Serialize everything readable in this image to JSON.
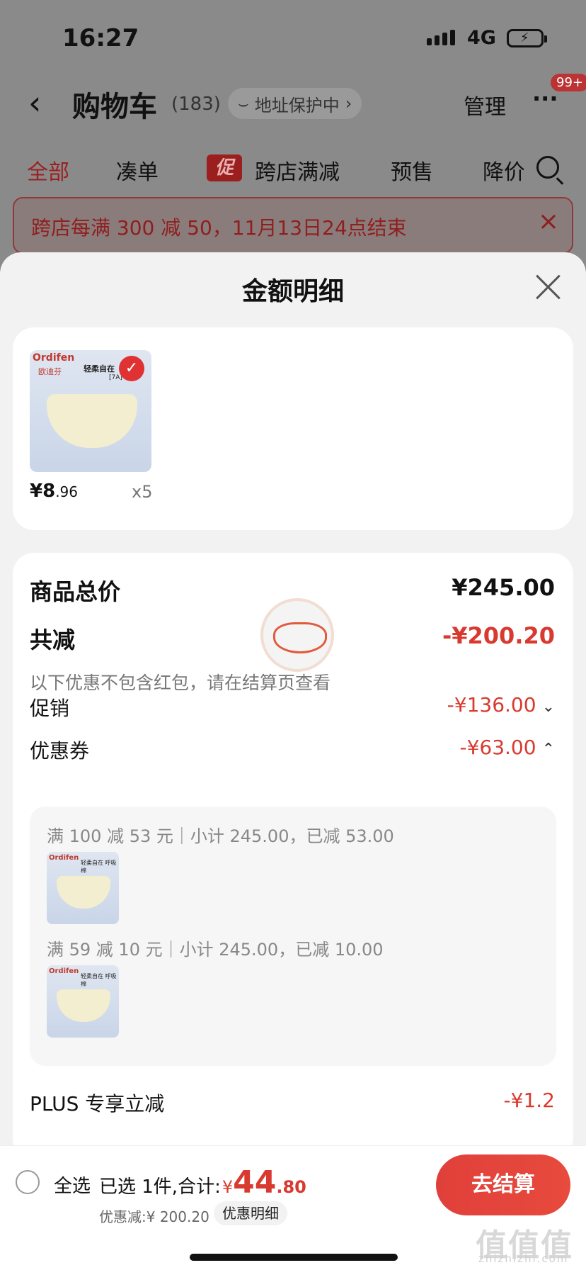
{
  "status": {
    "time": "16:27",
    "network": "4G"
  },
  "nav": {
    "back": "‹",
    "title": "购物车",
    "count": "(183)",
    "address": "地址保护中",
    "manage": "管理",
    "more": "···",
    "badge": "99+"
  },
  "tabs": {
    "items": [
      "全部",
      "凑单",
      "跨店满减",
      "预售",
      "降价"
    ],
    "promo_tag": "促"
  },
  "banner": {
    "text": "跨店每满 300 减 50，11月13日24点结束"
  },
  "sheet": {
    "title": "金额明细",
    "item": {
      "brand": "Ordifen",
      "brand_cn": "欧迪芬",
      "tagline": "轻柔自在",
      "tagline2": "[7A]",
      "price_int": "¥8",
      "price_dec": ".96",
      "qty": "x5"
    },
    "summary": {
      "total_label": "商品总价",
      "total_value": "¥245.00",
      "reduce_label": "共减",
      "reduce_value": "-¥200.20",
      "note": "以下优惠不包含红包，请在结算页查看",
      "promo_label": "促销",
      "promo_value": "-¥136.00",
      "coupon_label": "优惠券",
      "coupon_value": "-¥63.00",
      "coupon1": "满 100 减 53 元｜小计 245.00，已减 53.00",
      "coupon2": "满 59 减 10 元｜小计 245.00，已减 10.00",
      "mini_brand": "Ordifen",
      "mini_tagline": "轻柔自在 呼吸棉",
      "plus_label": "PLUS 专享立减",
      "plus_value": "-¥1.2"
    }
  },
  "bottom": {
    "select_all": "全选",
    "selected_text": "已选 1件,合计:",
    "yen": "¥",
    "total_int": "44",
    "total_dec": ".80",
    "discount": "优惠减:¥ 200.20",
    "detail": "优惠明细",
    "checkout": "去结算",
    "watermark": "值值值",
    "watermark_url": "zhizhizhi.com"
  },
  "colors": {
    "accent": "#d93a2f",
    "sheet_bg": "#f2f2f2"
  }
}
